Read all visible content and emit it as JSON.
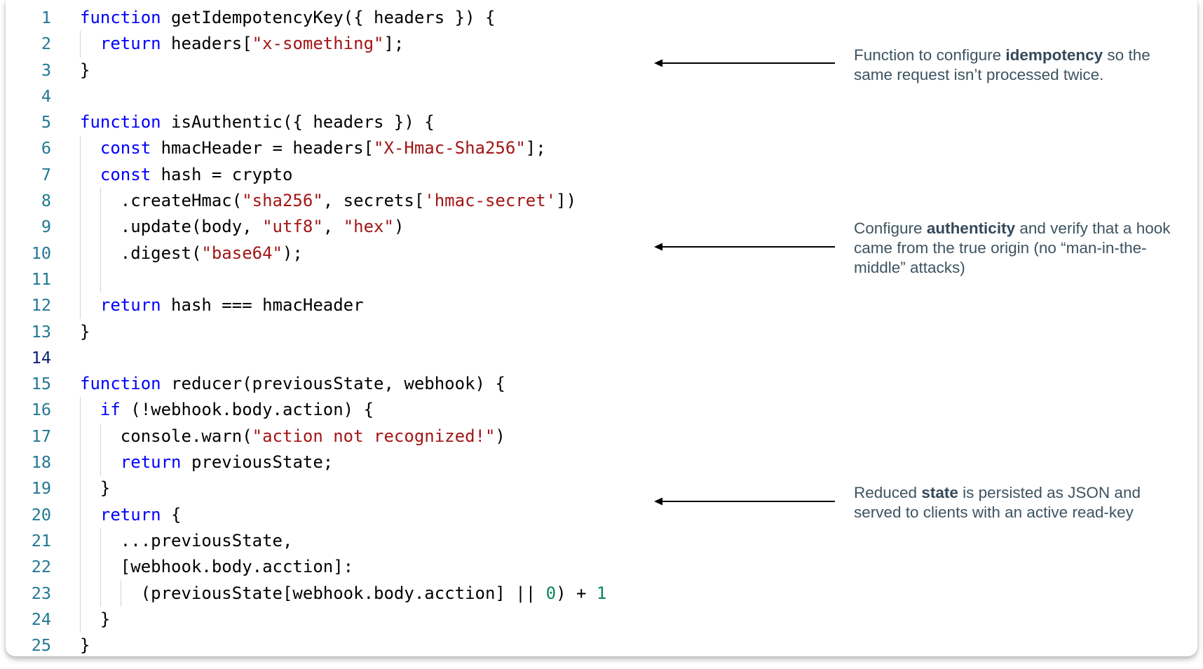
{
  "code": {
    "active_line": 14,
    "lines": [
      {
        "n": "1",
        "indent": 0,
        "tokens": [
          [
            "kw",
            "function"
          ],
          [
            "p",
            " getIdempotencyKey({ headers }) {"
          ]
        ]
      },
      {
        "n": "2",
        "indent": 1,
        "tokens": [
          [
            "kw",
            "return"
          ],
          [
            "p",
            " headers["
          ],
          [
            "str",
            "\"x-something\""
          ],
          [
            "p",
            "];"
          ]
        ]
      },
      {
        "n": "3",
        "indent": 0,
        "tokens": [
          [
            "p",
            "}"
          ]
        ]
      },
      {
        "n": "4",
        "indent": 0,
        "tokens": []
      },
      {
        "n": "5",
        "indent": 0,
        "tokens": [
          [
            "kw",
            "function"
          ],
          [
            "p",
            " isAuthentic({ headers }) {"
          ]
        ]
      },
      {
        "n": "6",
        "indent": 1,
        "tokens": [
          [
            "kw",
            "const"
          ],
          [
            "p",
            " hmacHeader = headers["
          ],
          [
            "str",
            "\"X-Hmac-Sha256\""
          ],
          [
            "p",
            "];"
          ]
        ]
      },
      {
        "n": "7",
        "indent": 1,
        "tokens": [
          [
            "kw",
            "const"
          ],
          [
            "p",
            " hash = crypto"
          ]
        ]
      },
      {
        "n": "8",
        "indent": 2,
        "tokens": [
          [
            "p",
            ".createHmac("
          ],
          [
            "str",
            "\"sha256\""
          ],
          [
            "p",
            ", secrets["
          ],
          [
            "str",
            "'hmac-secret'"
          ],
          [
            "p",
            "])"
          ]
        ]
      },
      {
        "n": "9",
        "indent": 2,
        "tokens": [
          [
            "p",
            ".update(body, "
          ],
          [
            "str",
            "\"utf8\""
          ],
          [
            "p",
            ", "
          ],
          [
            "str",
            "\"hex\""
          ],
          [
            "p",
            ")"
          ]
        ]
      },
      {
        "n": "10",
        "indent": 2,
        "tokens": [
          [
            "p",
            ".digest("
          ],
          [
            "str",
            "\"base64\""
          ],
          [
            "p",
            ");"
          ]
        ]
      },
      {
        "n": "11",
        "indent": 2,
        "tokens": []
      },
      {
        "n": "12",
        "indent": 1,
        "tokens": [
          [
            "kw",
            "return"
          ],
          [
            "p",
            " hash === hmacHeader"
          ]
        ]
      },
      {
        "n": "13",
        "indent": 0,
        "tokens": [
          [
            "p",
            "}"
          ]
        ]
      },
      {
        "n": "14",
        "indent": 0,
        "tokens": []
      },
      {
        "n": "15",
        "indent": 0,
        "tokens": [
          [
            "kw",
            "function"
          ],
          [
            "p",
            " reducer(previousState, webhook) {"
          ]
        ]
      },
      {
        "n": "16",
        "indent": 1,
        "tokens": [
          [
            "kw",
            "if"
          ],
          [
            "p",
            " (!webhook.body.action) {"
          ]
        ]
      },
      {
        "n": "17",
        "indent": 2,
        "tokens": [
          [
            "p",
            "console.warn("
          ],
          [
            "str",
            "\"action not recognized!\""
          ],
          [
            "p",
            ")"
          ]
        ]
      },
      {
        "n": "18",
        "indent": 2,
        "tokens": [
          [
            "kw",
            "return"
          ],
          [
            "p",
            " previousState;"
          ]
        ]
      },
      {
        "n": "19",
        "indent": 1,
        "tokens": [
          [
            "p",
            "}"
          ]
        ]
      },
      {
        "n": "20",
        "indent": 1,
        "tokens": [
          [
            "kw",
            "return"
          ],
          [
            "p",
            " {"
          ]
        ]
      },
      {
        "n": "21",
        "indent": 2,
        "tokens": [
          [
            "p",
            "...previousState,"
          ]
        ]
      },
      {
        "n": "22",
        "indent": 2,
        "tokens": [
          [
            "p",
            "[webhook.body.acction]:"
          ]
        ]
      },
      {
        "n": "23",
        "indent": 3,
        "tokens": [
          [
            "p",
            "(previousState[webhook.body.acction] || "
          ],
          [
            "num",
            "0"
          ],
          [
            "p",
            ") + "
          ],
          [
            "num",
            "1"
          ]
        ]
      },
      {
        "n": "24",
        "indent": 1,
        "tokens": [
          [
            "p",
            "}"
          ]
        ]
      },
      {
        "n": "25",
        "indent": 0,
        "tokens": [
          [
            "p",
            "}"
          ]
        ]
      }
    ]
  },
  "annotations": [
    {
      "pre": "Function to configure ",
      "bold": "idempotency",
      "post": " so the same request isn’t processed twice."
    },
    {
      "pre": "Configure ",
      "bold": "authenticity",
      "post": " and verify that a hook came from the true origin (no “man-in-the-middle” attacks)"
    },
    {
      "pre": "Reduced ",
      "bold": "state",
      "post": " is persisted as JSON and served to clients with an active read-key"
    }
  ]
}
